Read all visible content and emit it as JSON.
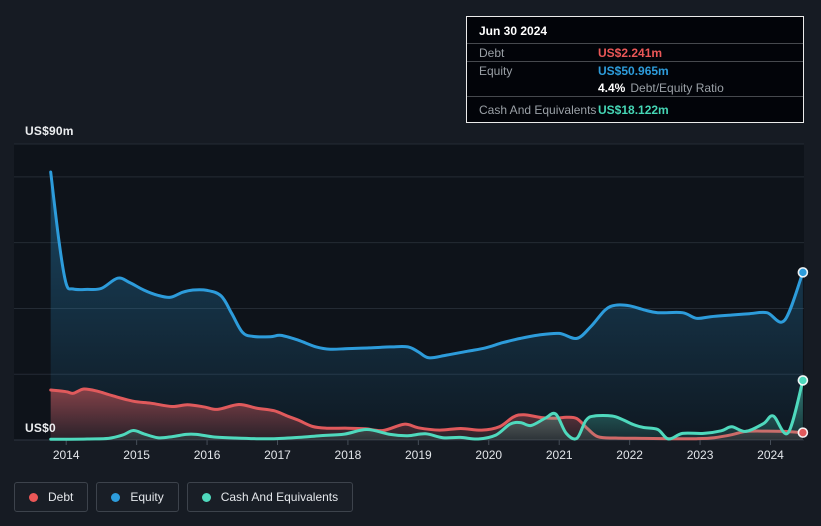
{
  "page": {
    "background": "#161b23"
  },
  "tooltip": {
    "date": "Jun 30 2024",
    "rows": [
      {
        "label": "Debt",
        "value": "US$2.241m",
        "color": "#eb5757"
      },
      {
        "label": "Equity",
        "value": "US$50.965m",
        "color": "#2d9cdb"
      },
      {
        "label": "Cash And Equivalents",
        "value": "US$18.122m",
        "color": "#45d6b5"
      }
    ],
    "ratio_bold": "4.4%",
    "ratio_text": "Debt/Equity Ratio"
  },
  "y_axis": {
    "top_label": "US$90m",
    "bottom_label": "US$0"
  },
  "legend": {
    "items": [
      {
        "label": "Debt",
        "color": "#eb5757"
      },
      {
        "label": "Equity",
        "color": "#2d9cdb"
      },
      {
        "label": "Cash And Equivalents",
        "color": "#4fd9bd"
      }
    ]
  },
  "chart_data": {
    "type": "area",
    "title": "Debt to Equity History",
    "x_unit": "year",
    "y_unit": "US$ millions",
    "ylim": [
      0,
      90
    ],
    "xlim": [
      2013.26,
      2024.48
    ],
    "grid_values": [
      0,
      20,
      40,
      60,
      80,
      90
    ],
    "x_ticks": [
      "2014",
      "2015",
      "2016",
      "2017",
      "2018",
      "2019",
      "2020",
      "2021",
      "2022",
      "2023",
      "2024"
    ],
    "latest_point": {
      "date": "Jun 30 2024",
      "debt": 2.241,
      "equity": 50.965,
      "cash": 18.122,
      "debt_equity_ratio_pct": 4.4
    },
    "series": [
      {
        "name": "Debt",
        "color": "#e05a5c",
        "fill_top": 0.55,
        "fill_bottom": 0.12,
        "points": [
          [
            2013.78,
            15.2
          ],
          [
            2014.0,
            14.7
          ],
          [
            2014.1,
            14.2
          ],
          [
            2014.25,
            15.5
          ],
          [
            2014.45,
            14.8
          ],
          [
            2014.65,
            13.5
          ],
          [
            2014.95,
            11.8
          ],
          [
            2015.2,
            11.2
          ],
          [
            2015.5,
            10.2
          ],
          [
            2015.72,
            10.7
          ],
          [
            2015.95,
            10.1
          ],
          [
            2016.15,
            9.3
          ],
          [
            2016.45,
            10.8
          ],
          [
            2016.7,
            9.7
          ],
          [
            2016.95,
            8.9
          ],
          [
            2017.15,
            7.2
          ],
          [
            2017.3,
            6.0
          ],
          [
            2017.5,
            4.1
          ],
          [
            2017.7,
            3.6
          ],
          [
            2018.0,
            3.6
          ],
          [
            2018.25,
            3.4
          ],
          [
            2018.5,
            2.9
          ],
          [
            2018.8,
            4.8
          ],
          [
            2019.0,
            3.7
          ],
          [
            2019.3,
            3.0
          ],
          [
            2019.6,
            3.5
          ],
          [
            2019.9,
            3.0
          ],
          [
            2020.15,
            4.0
          ],
          [
            2020.35,
            7.0
          ],
          [
            2020.5,
            7.7
          ],
          [
            2020.75,
            6.8
          ],
          [
            2020.95,
            6.6
          ],
          [
            2021.1,
            6.9
          ],
          [
            2021.25,
            6.5
          ],
          [
            2021.4,
            3.5
          ],
          [
            2021.55,
            1.0
          ],
          [
            2021.8,
            0.6
          ],
          [
            2022.2,
            0.5
          ],
          [
            2022.6,
            0.4
          ],
          [
            2022.95,
            0.4
          ],
          [
            2023.2,
            0.7
          ],
          [
            2023.45,
            1.6
          ],
          [
            2023.65,
            2.6
          ],
          [
            2023.95,
            2.7
          ],
          [
            2024.2,
            2.6
          ],
          [
            2024.46,
            2.241
          ]
        ]
      },
      {
        "name": "Equity",
        "color": "#2d9cdb",
        "fill_top": 0.38,
        "fill_bottom": 0.04,
        "points": [
          [
            2013.78,
            81.5
          ],
          [
            2013.9,
            60.0
          ],
          [
            2014.0,
            47.5
          ],
          [
            2014.1,
            45.9
          ],
          [
            2014.3,
            45.8
          ],
          [
            2014.5,
            46.1
          ],
          [
            2014.73,
            49.2
          ],
          [
            2014.9,
            47.9
          ],
          [
            2015.1,
            45.6
          ],
          [
            2015.3,
            44.0
          ],
          [
            2015.48,
            43.4
          ],
          [
            2015.65,
            44.9
          ],
          [
            2015.8,
            45.6
          ],
          [
            2016.0,
            45.5
          ],
          [
            2016.2,
            43.8
          ],
          [
            2016.35,
            38.5
          ],
          [
            2016.5,
            32.8
          ],
          [
            2016.65,
            31.5
          ],
          [
            2016.9,
            31.4
          ],
          [
            2017.05,
            31.8
          ],
          [
            2017.3,
            30.3
          ],
          [
            2017.55,
            28.3
          ],
          [
            2017.75,
            27.6
          ],
          [
            2018.0,
            27.8
          ],
          [
            2018.3,
            28.0
          ],
          [
            2018.6,
            28.3
          ],
          [
            2018.85,
            28.3
          ],
          [
            2019.0,
            26.8
          ],
          [
            2019.15,
            25.0
          ],
          [
            2019.4,
            25.8
          ],
          [
            2019.7,
            27.0
          ],
          [
            2019.95,
            28.0
          ],
          [
            2020.2,
            29.6
          ],
          [
            2020.45,
            30.9
          ],
          [
            2020.7,
            31.9
          ],
          [
            2021.0,
            32.4
          ],
          [
            2021.25,
            30.9
          ],
          [
            2021.45,
            34.5
          ],
          [
            2021.65,
            39.5
          ],
          [
            2021.8,
            41.0
          ],
          [
            2022.0,
            40.8
          ],
          [
            2022.2,
            39.6
          ],
          [
            2022.4,
            38.7
          ],
          [
            2022.75,
            38.7
          ],
          [
            2022.95,
            37.0
          ],
          [
            2023.15,
            37.5
          ],
          [
            2023.45,
            38.0
          ],
          [
            2023.7,
            38.4
          ],
          [
            2023.95,
            38.7
          ],
          [
            2024.2,
            36.4
          ],
          [
            2024.46,
            50.965
          ]
        ]
      },
      {
        "name": "Cash And Equivalents",
        "color": "#4fd9bd",
        "fill_top": 0.5,
        "fill_bottom": 0.1,
        "points": [
          [
            2013.78,
            0.2
          ],
          [
            2014.3,
            0.3
          ],
          [
            2014.6,
            0.5
          ],
          [
            2014.8,
            1.5
          ],
          [
            2014.95,
            2.9
          ],
          [
            2015.1,
            1.9
          ],
          [
            2015.3,
            0.7
          ],
          [
            2015.5,
            1.0
          ],
          [
            2015.7,
            1.7
          ],
          [
            2015.85,
            1.7
          ],
          [
            2016.1,
            0.9
          ],
          [
            2016.4,
            0.6
          ],
          [
            2016.7,
            0.4
          ],
          [
            2016.95,
            0.4
          ],
          [
            2017.3,
            0.8
          ],
          [
            2017.6,
            1.3
          ],
          [
            2017.95,
            1.8
          ],
          [
            2018.27,
            3.2
          ],
          [
            2018.6,
            1.7
          ],
          [
            2018.85,
            1.3
          ],
          [
            2019.1,
            1.9
          ],
          [
            2019.35,
            0.7
          ],
          [
            2019.6,
            0.8
          ],
          [
            2019.85,
            0.3
          ],
          [
            2020.1,
            1.5
          ],
          [
            2020.3,
            4.8
          ],
          [
            2020.45,
            5.3
          ],
          [
            2020.6,
            4.4
          ],
          [
            2020.8,
            6.6
          ],
          [
            2020.95,
            7.9
          ],
          [
            2021.1,
            2.0
          ],
          [
            2021.25,
            0.5
          ],
          [
            2021.38,
            6.0
          ],
          [
            2021.5,
            7.3
          ],
          [
            2021.75,
            7.3
          ],
          [
            2021.9,
            6.2
          ],
          [
            2022.05,
            4.7
          ],
          [
            2022.2,
            3.8
          ],
          [
            2022.4,
            3.2
          ],
          [
            2022.55,
            0.3
          ],
          [
            2022.75,
            2.0
          ],
          [
            2023.05,
            2.0
          ],
          [
            2023.3,
            2.8
          ],
          [
            2023.45,
            4.0
          ],
          [
            2023.65,
            2.6
          ],
          [
            2023.9,
            5.0
          ],
          [
            2024.04,
            7.3
          ],
          [
            2024.25,
            2.2
          ],
          [
            2024.46,
            18.122
          ]
        ]
      }
    ]
  }
}
